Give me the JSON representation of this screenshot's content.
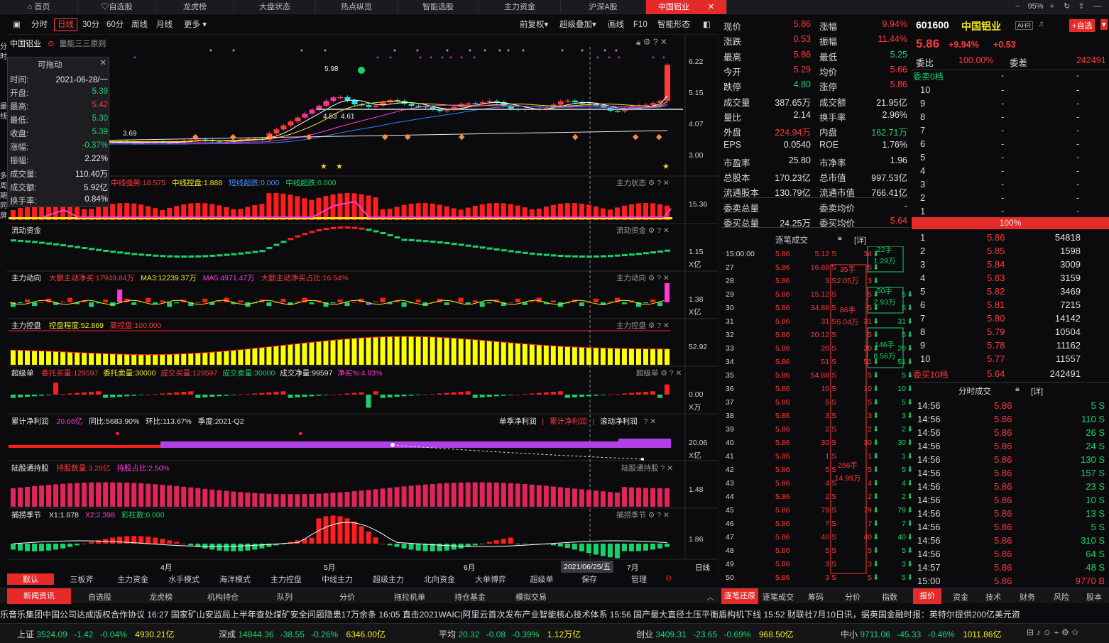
{
  "top_tabs": [
    "首页",
    "自选股",
    "龙虎榜",
    "大盘状态",
    "热点纵览",
    "智能选股",
    "主力资金",
    "沪深A股",
    "中国铝业"
  ],
  "top_right": {
    "zoom": "95%"
  },
  "toolbar": {
    "left": [
      "分时",
      "日线",
      "30分",
      "60分",
      "周线",
      "月线",
      "更多"
    ],
    "right": [
      "前复权",
      "超级叠加",
      "画线",
      "F10",
      "智能形态"
    ]
  },
  "stock_name": "中国铝业",
  "rule_label": "量能三三原则",
  "infobox": {
    "title": "可拖动",
    "rows": [
      {
        "label": "时间:",
        "value": "2021-06-28/一"
      },
      {
        "label": "开盘:",
        "value": "5.39"
      },
      {
        "label": "最高:",
        "value": "5.42"
      },
      {
        "label": "最低:",
        "value": "5.30"
      },
      {
        "label": "收盘:",
        "value": "5.39"
      },
      {
        "label": "涨幅:",
        "value": "-0.37%"
      },
      {
        "label": "振幅:",
        "value": "2.22%"
      },
      {
        "label": "成交量:",
        "value": "110.40万"
      },
      {
        "label": "成交额:",
        "value": "5.92亿"
      },
      {
        "label": "换手率:",
        "value": "0.84%"
      }
    ]
  },
  "price_axis": [
    "6.22",
    "5.15",
    "4.07",
    "3.00"
  ],
  "price_labels": {
    "hi": "5.98",
    "mid": "4.53",
    "mid2": "4.61",
    "lo": "3.69"
  },
  "panels": [
    {
      "id": "state",
      "right_title": "主力状态",
      "items": [
        "中线强势:18.575",
        "中线控盘:1.888",
        "短线超跌:0.000",
        "中线超跌:0.000"
      ],
      "axis": [
        "15.36"
      ]
    },
    {
      "id": "flow",
      "left_title": "流动资金",
      "right_title": "流动资金",
      "axis": [
        "1.15",
        "X亿"
      ]
    },
    {
      "id": "move",
      "left_title": "主力动向",
      "items": [
        "大额主动净买:17949.84万",
        "MA3:12239.37万",
        "MA5:4971.47万",
        "大额主动净买占比:16.54%"
      ],
      "right_title": "主力动向",
      "axis": [
        "1.38",
        "X亿"
      ]
    },
    {
      "id": "control",
      "left_title": "主力控盘",
      "items": [
        "控盘程度:52.869",
        "高控盘:100.000"
      ],
      "right_title": "主力控盘",
      "axis": [
        "52.92"
      ]
    },
    {
      "id": "super",
      "left_title": "超级单",
      "items": [
        "委托买量:129597",
        "委托卖量:30000",
        "成交买量:129597",
        "成交卖量:30000",
        "成交净量:99597",
        "净买%:4.93%"
      ],
      "right_title": "超级单",
      "axis": [
        "0.00",
        "X万"
      ]
    },
    {
      "id": "profit",
      "left_title": "累计净利润",
      "items": [
        "20.66亿",
        "同比:5683.90%",
        "环比:113.67%",
        "季度:2021-Q2"
      ],
      "switch": [
        "单季净利润",
        "累计净利润",
        "滚动净利润"
      ],
      "axis": [
        "20.06",
        "X亿"
      ]
    },
    {
      "id": "hk",
      "left_title": "陆股通持股",
      "items": [
        "持股数量:3.28亿",
        "持股占比:2.50%"
      ],
      "right_title": "陆股通持股",
      "axis": [
        "1.48"
      ]
    },
    {
      "id": "season",
      "left_title": "捕捞季节",
      "items": [
        "X1:1.878",
        "X2:2.398",
        "彩柱数:0.000"
      ],
      "right_title": "捕捞季节",
      "axis": [
        "1.86"
      ]
    }
  ],
  "xaxis": {
    "labels": [
      "4月",
      "5月",
      "6月",
      "7月"
    ],
    "cursor_date": "2021/06/25/五",
    "period": "日线"
  },
  "bottom_tabs": [
    "默认",
    "三板斧",
    "主力资金",
    "水手模式",
    "海洋模式",
    "主力控盘",
    "中线主力",
    "超级主力",
    "北向资金",
    "大单博弈",
    "超级单",
    "保存",
    "管理"
  ],
  "quote": [
    [
      "现价",
      "5.86",
      "涨幅",
      "9.94%"
    ],
    [
      "涨跌",
      "0.53",
      "振幅",
      "11.44%"
    ],
    [
      "最高",
      "5.86",
      "最低",
      "5.25"
    ],
    [
      "今开",
      "5.29",
      "均价",
      "5.66"
    ],
    [
      "跌停",
      "4.80",
      "涨停",
      "5.86"
    ],
    [
      "成交量",
      "387.65万",
      "成交额",
      "21.95亿"
    ],
    [
      "量比",
      "2.14",
      "换手率",
      "2.96%"
    ],
    [
      "外盘",
      "224.94万",
      "内盘",
      "162.71万"
    ],
    [
      "EPS",
      "0.0540",
      "ROE",
      "1.76%"
    ],
    [
      "市盈率",
      "25.80",
      "市净率",
      "1.96"
    ],
    [
      "总股本",
      "170.23亿",
      "总市值",
      "997.53亿"
    ],
    [
      "流通股本",
      "130.79亿",
      "流通市值",
      "766.41亿"
    ],
    [
      "委卖总量",
      "",
      "委卖均价",
      "-"
    ],
    [
      "委买总量",
      "24.25万",
      "委买均价",
      "5.64"
    ]
  ],
  "trades": {
    "title": "逐笔成交",
    "detail": "[详]",
    "rows": [
      [
        "15:00:00",
        "5.86",
        "5.12 S",
        "34"
      ],
      [
        "27",
        "5.86",
        "16.88 S",
        "5"
      ],
      [
        "28",
        "5.86",
        "3 S",
        "3"
      ],
      [
        "29",
        "5.86",
        "15.12 S",
        "5"
      ],
      [
        "30",
        "5.86",
        "34.88 S",
        "5"
      ],
      [
        "31",
        "5.86",
        "31 S",
        "31"
      ],
      [
        "32",
        "5.86",
        "20.12 S",
        "5"
      ],
      [
        "33",
        "5.86",
        "20 S",
        "20"
      ],
      [
        "34",
        "5.86",
        "51 S",
        "51"
      ],
      [
        "35",
        "5.86",
        "54.88 S",
        "5"
      ],
      [
        "36",
        "5.86",
        "10 S",
        "10"
      ],
      [
        "37",
        "5.86",
        "5 S",
        "5"
      ],
      [
        "38",
        "5.86",
        "3 S",
        "3"
      ],
      [
        "39",
        "5.86",
        "2 S",
        "2"
      ],
      [
        "40",
        "5.86",
        "30 S",
        "30"
      ],
      [
        "41",
        "5.86",
        "1 S",
        "1"
      ],
      [
        "42",
        "5.86",
        "5 S",
        "5"
      ],
      [
        "43",
        "5.86",
        "4 S",
        "4"
      ],
      [
        "44",
        "5.86",
        "2 S",
        "2"
      ],
      [
        "45",
        "5.86",
        "79 S",
        "79"
      ],
      [
        "46",
        "5.86",
        "7 S",
        "7"
      ],
      [
        "47",
        "5.86",
        "40 S",
        "40"
      ],
      [
        "48",
        "5.86",
        "5 S",
        "5"
      ],
      [
        "49",
        "5.86",
        "3 S",
        "3"
      ],
      [
        "50",
        "5.86",
        "3 S",
        "5"
      ]
    ],
    "boxes": [
      [
        "22手",
        "1.29万"
      ],
      [
        "35手",
        "2.05万"
      ],
      [
        "50手",
        "2.93万"
      ],
      [
        "86手",
        "5.04万"
      ],
      [
        "146手",
        "8.56万"
      ],
      [
        "256手",
        "14.99万"
      ]
    ]
  },
  "book": {
    "code": "601600",
    "name": "中国铝业",
    "tag": "AHR",
    "add": "+自选",
    "price": "5.86",
    "chg": "+9.94%",
    "chgv": "+0.53",
    "ratio_label": "委比",
    "ratio": "100.00%",
    "diff_label": "委差",
    "diff": "242491",
    "sell0": "委卖0档",
    "sells": [
      "10",
      "9",
      "8",
      "7",
      "6",
      "5",
      "4",
      "3",
      "2",
      "1"
    ],
    "bar": "100%",
    "buys": [
      [
        "1",
        "5.86",
        "54818"
      ],
      [
        "2",
        "5.85",
        "1598"
      ],
      [
        "3",
        "5.84",
        "3009"
      ],
      [
        "4",
        "5.83",
        "3159"
      ],
      [
        "5",
        "5.82",
        "3469"
      ],
      [
        "6",
        "5.81",
        "7215"
      ],
      [
        "7",
        "5.80",
        "14142"
      ],
      [
        "8",
        "5.79",
        "10504"
      ],
      [
        "9",
        "5.78",
        "11162"
      ],
      [
        "10",
        "5.77",
        "11557"
      ]
    ],
    "buy10": [
      "委买10档",
      "5.64",
      "242491"
    ],
    "minute_title": "分时成交",
    "minute_detail": "[详]",
    "minutes": [
      [
        "14:56",
        "5.86",
        "5 S"
      ],
      [
        "14:56",
        "5.86",
        "110 S"
      ],
      [
        "14:56",
        "5.86",
        "26 S"
      ],
      [
        "14:56",
        "5.86",
        "24 S"
      ],
      [
        "14:56",
        "5.86",
        "130 S"
      ],
      [
        "14:56",
        "5.86",
        "157 S"
      ],
      [
        "14:56",
        "5.86",
        "23 S"
      ],
      [
        "14:56",
        "5.86",
        "10 S"
      ],
      [
        "14:56",
        "5.86",
        "13 S"
      ],
      [
        "14:56",
        "5.86",
        "5 S"
      ],
      [
        "14:56",
        "5.86",
        "310 S"
      ],
      [
        "14:56",
        "5.86",
        "64 S"
      ],
      [
        "14:57",
        "5.86",
        "48 S"
      ],
      [
        "15:00",
        "5.86",
        "9770 B"
      ]
    ]
  },
  "lower_tabs": [
    "新闻资讯",
    "自选股",
    "龙虎榜",
    "机构持仓",
    "队列",
    "分价",
    "拖拉机单",
    "持仓基金",
    "模拟交易"
  ],
  "lower_right_tabs": [
    "逐笔还原",
    "逐笔成交",
    "筹码",
    "分价",
    "指数",
    "报价",
    "资金",
    "技术",
    "财务",
    "风险",
    "股本"
  ],
  "ticker": "乐音乐集团中国公司达成版权合作协议    16:27 国家矿山安监局上半年查处煤矿安全问题隐患17万余条    16:05 直击2021WAIC|阿里云首次发布产业智能核心技术体系    15:56 国产最大直径土压平衡盾构机下线    15:52 财联社7月10日讯，据英国金融时报：英特尔提供200亿美元资",
  "indices": [
    {
      "name": "上证",
      "val": "3524.09",
      "chg": "-1.42",
      "pct": "-0.04%",
      "amt": "4930.21亿"
    },
    {
      "name": "深成",
      "val": "14844.36",
      "chg": "-38.55",
      "pct": "-0.26%",
      "amt": "6346.00亿"
    },
    {
      "name": "平均",
      "val": "20.32",
      "chg": "-0.08",
      "pct": "-0.39%",
      "amt": "1.12万亿"
    },
    {
      "name": "创业",
      "val": "3409.31",
      "chg": "-23.65",
      "pct": "-0.69%",
      "amt": "968.50亿"
    },
    {
      "name": "中小",
      "val": "9711.06",
      "chg": "-45.33",
      "pct": "-0.46%",
      "amt": "1011.86亿"
    }
  ]
}
